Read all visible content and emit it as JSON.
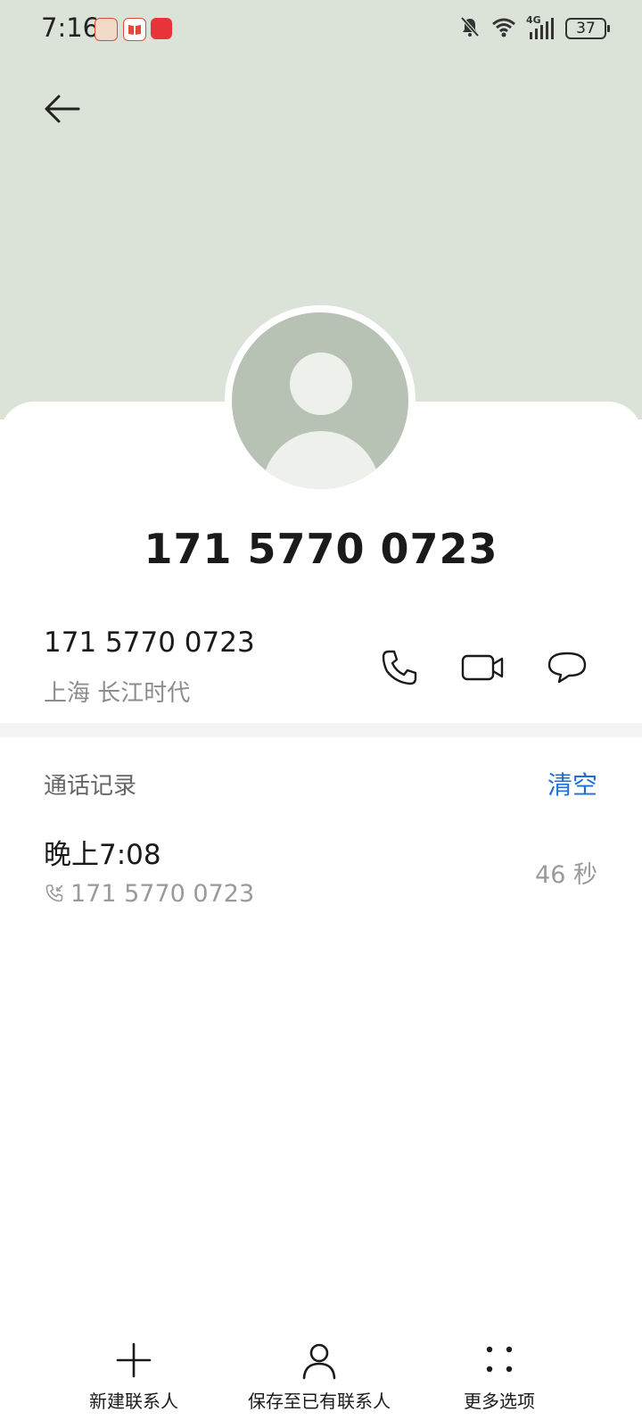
{
  "status_bar": {
    "time": "7:16",
    "network": "4G",
    "battery": "37"
  },
  "contact": {
    "title": "171 5770 0723"
  },
  "number_row": {
    "number": "171 5770 0723",
    "location": "上海 长江时代"
  },
  "call_log": {
    "section_title": "通话记录",
    "clear_label": "清空",
    "records": [
      {
        "time": "晚上7:08",
        "number": "171 5770 0723",
        "duration": "46 秒"
      }
    ]
  },
  "bottom_actions": {
    "new_contact": "新建联系人",
    "save_existing": "保存至已有联系人",
    "more_options": "更多选项"
  },
  "colors": {
    "header_bg": "#dbe2d8",
    "accent_blue": "#1f6ed4",
    "avatar_bg": "#b7c2b4"
  }
}
